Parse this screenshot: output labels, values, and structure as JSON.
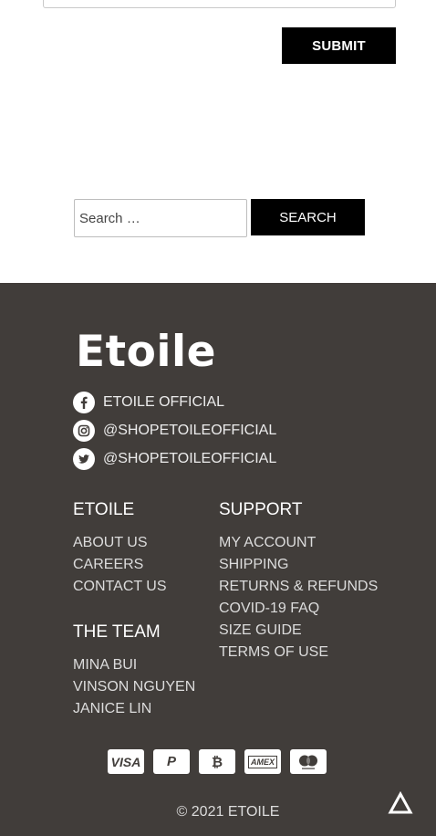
{
  "form": {
    "submit_label": "SUBMIT"
  },
  "search": {
    "placeholder": "Search …",
    "button_label": "SEARCH"
  },
  "footer": {
    "logo": "Etoile",
    "social": [
      {
        "icon": "facebook-icon",
        "label": "ETOILE OFFICIAL"
      },
      {
        "icon": "instagram-icon",
        "label": "@SHOPETOILEOFFICIAL"
      },
      {
        "icon": "twitter-icon",
        "label": "@SHOPETOILEOFFICIAL"
      }
    ],
    "etoile": {
      "title": "ETOILE",
      "links": [
        "ABOUT US",
        "CAREERS",
        "CONTACT US"
      ]
    },
    "team": {
      "title": "THE TEAM",
      "members": [
        "MINA BUI",
        "VINSON NGUYEN",
        "JANICE LIN"
      ]
    },
    "support": {
      "title": "SUPPORT",
      "links": [
        "MY ACCOUNT",
        "SHIPPING",
        "RETURNS & REFUNDS",
        "COVID-19 FAQ",
        "SIZE GUIDE",
        "TERMS OF USE"
      ]
    },
    "payments": [
      {
        "icon": "visa-icon",
        "label": "VISA"
      },
      {
        "icon": "paypal-icon",
        "label": "P"
      },
      {
        "icon": "bitcoin-icon",
        "label": "₿"
      },
      {
        "icon": "amex-icon",
        "label": "AMEX"
      },
      {
        "icon": "mastercard-icon",
        "label": ""
      }
    ],
    "copyright": "© 2021 ETOILE"
  },
  "colors": {
    "footer_bg": "#413d3a",
    "button_bg": "#000000",
    "text_light": "#e6e6e6"
  }
}
